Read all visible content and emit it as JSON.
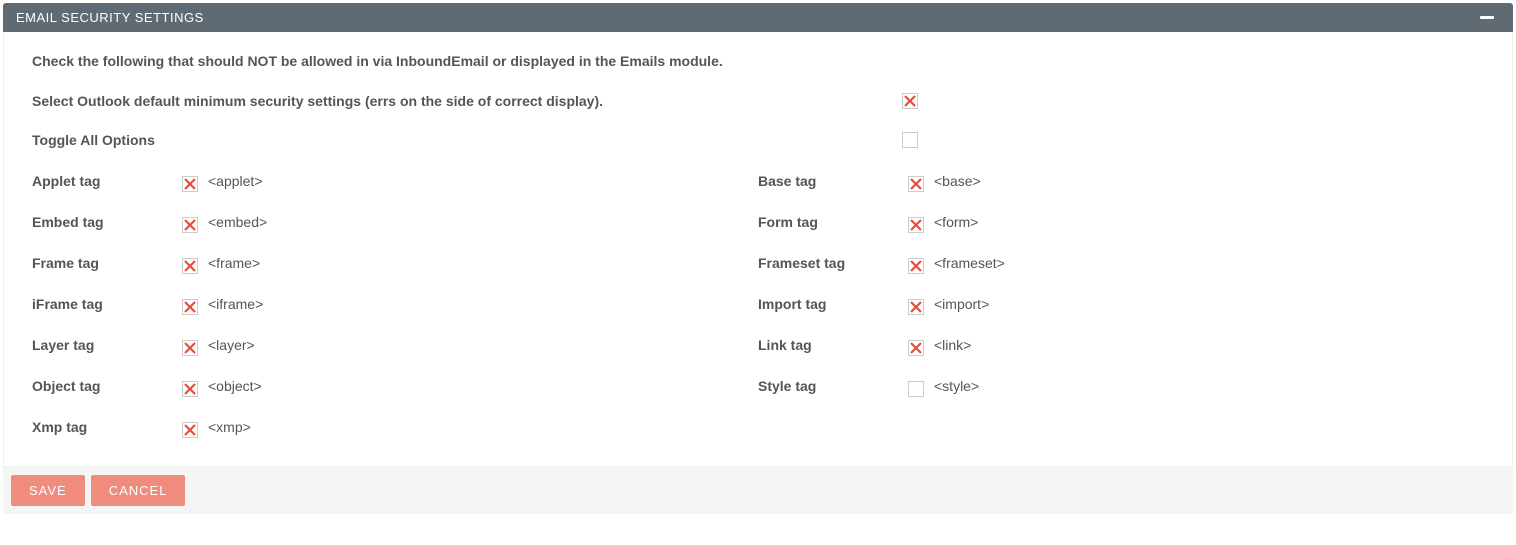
{
  "header": {
    "title": "EMAIL SECURITY SETTINGS"
  },
  "intro": "Check the following that should NOT be allowed in via InboundEmail or displayed in the Emails module.",
  "outlook": {
    "label": "Select Outlook default minimum security settings (errs on the side of correct display).",
    "checked": true
  },
  "toggle_all": {
    "label": "Toggle All Options",
    "checked": false
  },
  "tags": {
    "left": [
      {
        "label": "Applet tag",
        "value": "<applet>",
        "checked": true
      },
      {
        "label": "Embed tag",
        "value": "<embed>",
        "checked": true
      },
      {
        "label": "Frame tag",
        "value": "<frame>",
        "checked": true
      },
      {
        "label": "iFrame tag",
        "value": "<iframe>",
        "checked": true
      },
      {
        "label": "Layer tag",
        "value": "<layer>",
        "checked": true
      },
      {
        "label": "Object tag",
        "value": "<object>",
        "checked": true
      },
      {
        "label": "Xmp tag",
        "value": "<xmp>",
        "checked": true
      }
    ],
    "right": [
      {
        "label": "Base tag",
        "value": "<base>",
        "checked": true
      },
      {
        "label": "Form tag",
        "value": "<form>",
        "checked": true
      },
      {
        "label": "Frameset tag",
        "value": "<frameset>",
        "checked": true
      },
      {
        "label": "Import tag",
        "value": "<import>",
        "checked": true
      },
      {
        "label": "Link tag",
        "value": "<link>",
        "checked": true
      },
      {
        "label": "Style tag",
        "value": "<style>",
        "checked": false
      }
    ]
  },
  "buttons": {
    "save": "SAVE",
    "cancel": "CANCEL"
  }
}
